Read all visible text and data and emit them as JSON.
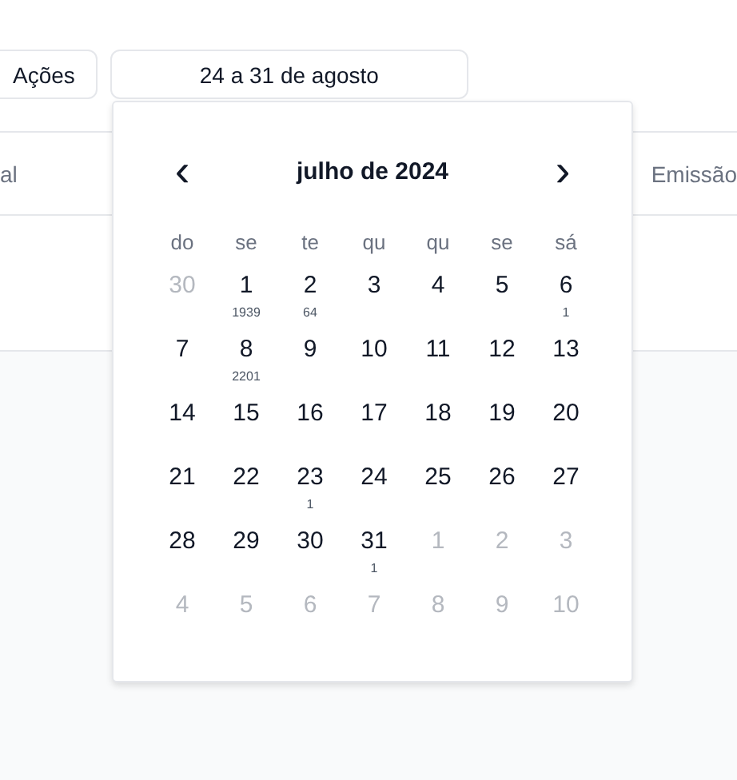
{
  "toolbar": {
    "actions_button": "Ações",
    "date_range_button": "24 a 31 de agosto"
  },
  "table_header": {
    "columns": [
      "al",
      "Emissão"
    ]
  },
  "calendar": {
    "month": "julho de 2024",
    "prev": "‹",
    "next": "›",
    "weekdays": [
      "do",
      "se",
      "te",
      "qu",
      "qu",
      "se",
      "sá"
    ],
    "days": [
      {
        "day": "30",
        "outside": true
      },
      {
        "day": "1",
        "outside": false,
        "count": "1939"
      },
      {
        "day": "2",
        "outside": false,
        "count": "64"
      },
      {
        "day": "3",
        "outside": false
      },
      {
        "day": "4",
        "outside": false
      },
      {
        "day": "5",
        "outside": false
      },
      {
        "day": "6",
        "outside": false,
        "count": "1"
      },
      {
        "day": "7",
        "outside": false
      },
      {
        "day": "8",
        "outside": false,
        "count": "2201"
      },
      {
        "day": "9",
        "outside": false
      },
      {
        "day": "10",
        "outside": false
      },
      {
        "day": "11",
        "outside": false
      },
      {
        "day": "12",
        "outside": false
      },
      {
        "day": "13",
        "outside": false
      },
      {
        "day": "14",
        "outside": false
      },
      {
        "day": "15",
        "outside": false
      },
      {
        "day": "16",
        "outside": false
      },
      {
        "day": "17",
        "outside": false
      },
      {
        "day": "18",
        "outside": false
      },
      {
        "day": "19",
        "outside": false
      },
      {
        "day": "20",
        "outside": false
      },
      {
        "day": "21",
        "outside": false
      },
      {
        "day": "22",
        "outside": false
      },
      {
        "day": "23",
        "outside": false,
        "count": "1"
      },
      {
        "day": "24",
        "outside": false
      },
      {
        "day": "25",
        "outside": false
      },
      {
        "day": "26",
        "outside": false
      },
      {
        "day": "27",
        "outside": false
      },
      {
        "day": "28",
        "outside": false
      },
      {
        "day": "29",
        "outside": false
      },
      {
        "day": "30",
        "outside": false
      },
      {
        "day": "31",
        "outside": false,
        "count": "1"
      },
      {
        "day": "1",
        "outside": true
      },
      {
        "day": "2",
        "outside": true
      },
      {
        "day": "3",
        "outside": true
      },
      {
        "day": "4",
        "outside": true
      },
      {
        "day": "5",
        "outside": true
      },
      {
        "day": "6",
        "outside": true
      },
      {
        "day": "7",
        "outside": true
      },
      {
        "day": "8",
        "outside": true
      },
      {
        "day": "9",
        "outside": true
      },
      {
        "day": "10",
        "outside": true
      }
    ]
  }
}
